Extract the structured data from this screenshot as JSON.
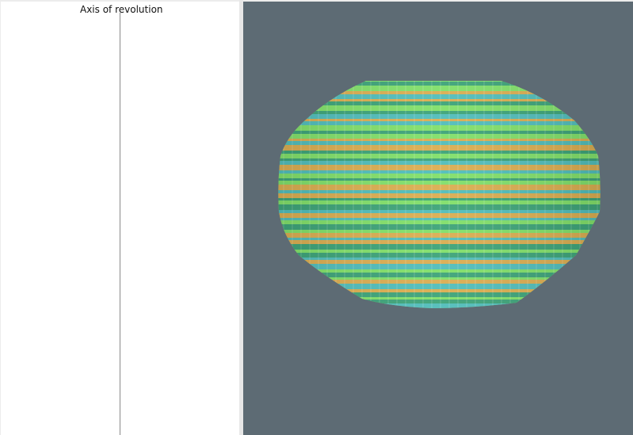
{
  "editor": {
    "axis_label": "Axis of revolution"
  },
  "viewport": {
    "background_color": "#5d6b74",
    "object_name": "solid-of-revolution",
    "band_colors": [
      "#7fe06a",
      "#a9d24a",
      "#3dc9a0",
      "#e7a64c",
      "#5aa0d8",
      "#c9d84a",
      "#2f9a7a",
      "#93e05a",
      "#d8b050",
      "#46b8c8",
      "#e28a3a",
      "#6ad08a"
    ]
  }
}
